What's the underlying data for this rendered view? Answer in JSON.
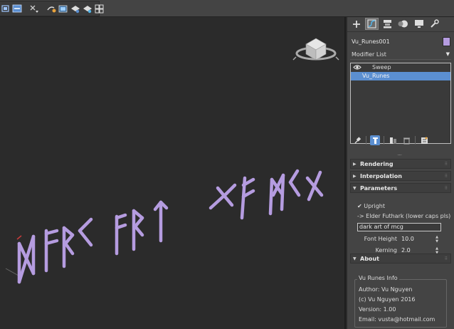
{
  "toolbar": {
    "buttons": [
      "snaps-toggle-icon",
      "align-icon",
      "named-selection-icon",
      "render-setup-icon",
      "rendered-frame-icon",
      "render-production-icon",
      "render-iterative-icon",
      "render-cloud-icon"
    ]
  },
  "viewport": {
    "rune_text": "dark art of mcg",
    "rune_color": "#b59ce0"
  },
  "panel": {
    "tabs": [
      "create-tab",
      "modify-tab",
      "hierarchy-tab",
      "motion-tab",
      "display-tab",
      "utilities-tab"
    ],
    "object_name": "Vu_Runes001",
    "object_color": "#b59ce0",
    "modifier_list_label": "Modifier List",
    "stack": [
      {
        "label": "Sweep",
        "selected": false
      },
      {
        "label": "Vu_Runes",
        "selected": true
      }
    ],
    "selection_color": "#5b8fd1",
    "rollouts": {
      "rendering": "Rendering",
      "interpolation": "Interpolation",
      "parameters": "Parameters",
      "about": "About"
    },
    "parameters": {
      "upright_label": "Upright",
      "upright_checked": true,
      "futhark_label": "-> Elder Futhark (lower caps pls)",
      "rune_text_value": "dark art of mcg",
      "font_height_label": "Font Height",
      "font_height_value": "10.0",
      "kerning_label": "Kerning",
      "kerning_value": "2.0"
    },
    "about": {
      "group_title": "Vu Runes Info",
      "author": "Author: Vu Nguyen",
      "copyright": "(c) Vu Nguyen 2016",
      "version": "Version: 1.00",
      "email": "Email: vusta@hotmail.com"
    }
  }
}
